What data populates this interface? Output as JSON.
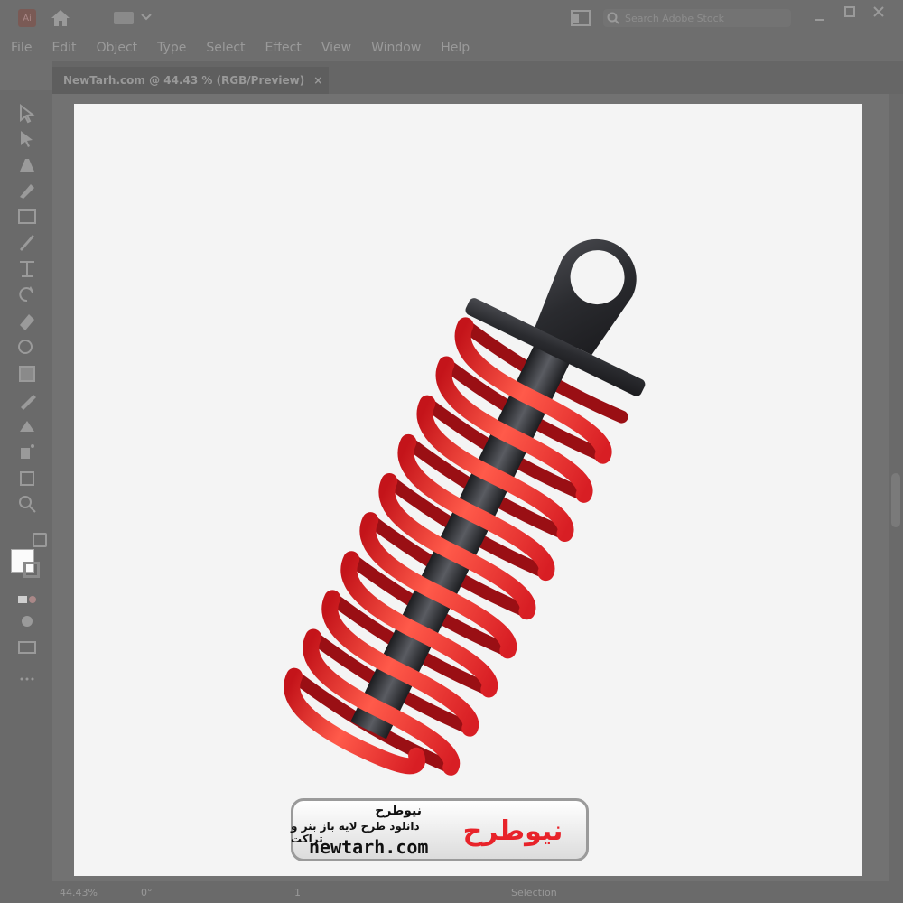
{
  "app": {
    "logo_text": "Ai",
    "search_placeholder": "Search Adobe Stock"
  },
  "menu": [
    "File",
    "Edit",
    "Object",
    "Type",
    "Select",
    "Effect",
    "View",
    "Window",
    "Help"
  ],
  "document_tab": {
    "label": "NewTarh.com @ 44.43 % (RGB/Preview)",
    "close": "×"
  },
  "status": {
    "zoom": "44.43%",
    "rotation": "0°",
    "artboard": "1",
    "tool": "Selection"
  },
  "watermark": {
    "title": "نیوطرح",
    "subtitle": "دانلود طرح لایه باز بنر و تراکت",
    "url": "newtarh.com",
    "logo_text": "نیوطرح"
  },
  "colors": {
    "spring_red": "#e5252a",
    "rod_dark": "#2e2f33",
    "accent_blue": "#1e6ae0"
  }
}
